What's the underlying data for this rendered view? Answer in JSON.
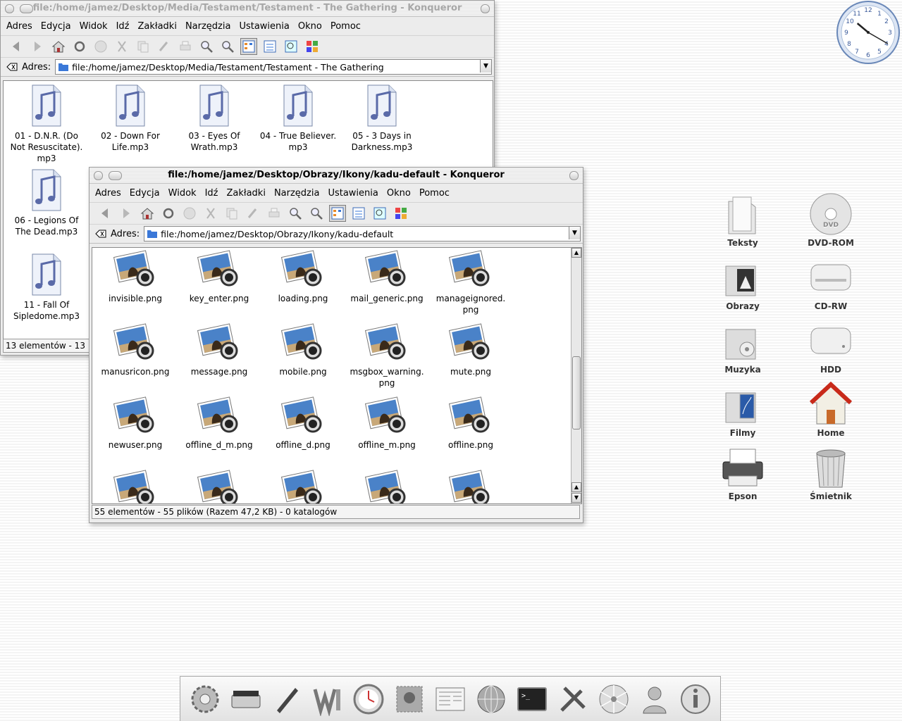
{
  "window1": {
    "title": "file:/home/jamez/Desktop/Media/Testament/Testament - The Gathering - Konqueror",
    "menu": [
      "Adres",
      "Edycja",
      "Widok",
      "Idź",
      "Zakładki",
      "Narzędzia",
      "Ustawienia",
      "Okno",
      "Pomoc"
    ],
    "address_label": "Adres:",
    "address_value": "file:/home/jamez/Desktop/Media/Testament/Testament - The Gathering",
    "files": [
      {
        "l1": "01 - D.N.R. (Do",
        "l2": "Not Resuscitate).",
        "l3": "mp3"
      },
      {
        "l1": "02 - Down For",
        "l2": "Life.mp3",
        "l3": ""
      },
      {
        "l1": "03 - Eyes Of",
        "l2": "Wrath.mp3",
        "l3": ""
      },
      {
        "l1": "04 - True Believer.",
        "l2": "mp3",
        "l3": ""
      },
      {
        "l1": "05 - 3 Days in",
        "l2": "Darkness.mp3",
        "l3": ""
      },
      {
        "l1": "06 - Legions Of",
        "l2": "The Dead.mp3",
        "l3": ""
      },
      {
        "l1": "11 - Fall Of",
        "l2": "Sipledome.mp3",
        "l3": ""
      }
    ],
    "status": "13 elementów - 13"
  },
  "window2": {
    "title": "file:/home/jamez/Desktop/Obrazy/Ikony/kadu-default - Konqueror",
    "menu": [
      "Adres",
      "Edycja",
      "Widok",
      "Idź",
      "Zakładki",
      "Narzędzia",
      "Ustawienia",
      "Okno",
      "Pomoc"
    ],
    "address_label": "Adres:",
    "address_value": "file:/home/jamez/Desktop/Obrazy/Ikony/kadu-default",
    "files": [
      {
        "l1": "invisible.png",
        "l2": ""
      },
      {
        "l1": "key_enter.png",
        "l2": ""
      },
      {
        "l1": "loading.png",
        "l2": ""
      },
      {
        "l1": "mail_generic.png",
        "l2": ""
      },
      {
        "l1": "manageignored.",
        "l2": "png"
      },
      {
        "l1": "manusricon.png",
        "l2": ""
      },
      {
        "l1": "message.png",
        "l2": ""
      },
      {
        "l1": "mobile.png",
        "l2": ""
      },
      {
        "l1": "msgbox_warning.",
        "l2": "png"
      },
      {
        "l1": "mute.png",
        "l2": ""
      },
      {
        "l1": "newuser.png",
        "l2": ""
      },
      {
        "l1": "offline_d_m.png",
        "l2": ""
      },
      {
        "l1": "offline_d.png",
        "l2": ""
      },
      {
        "l1": "offline_m.png",
        "l2": ""
      },
      {
        "l1": "offline.png",
        "l2": ""
      },
      {
        "l1": "",
        "l2": ""
      },
      {
        "l1": "",
        "l2": ""
      },
      {
        "l1": "",
        "l2": ""
      },
      {
        "l1": "",
        "l2": ""
      },
      {
        "l1": "",
        "l2": ""
      }
    ],
    "status": "55 elementów - 55 plików (Razem 47,2 KB) - 0 katalogów"
  },
  "desktop_icons": [
    {
      "label": "Teksty",
      "icon": "documents-folder-icon"
    },
    {
      "label": "DVD-ROM",
      "icon": "dvd-icon"
    },
    {
      "label": "Obrazy",
      "icon": "pictures-folder-icon"
    },
    {
      "label": "CD-RW",
      "icon": "cd-drive-icon"
    },
    {
      "label": "Muzyka",
      "icon": "music-folder-icon"
    },
    {
      "label": "HDD",
      "icon": "hard-disk-icon"
    },
    {
      "label": "Filmy",
      "icon": "movies-folder-icon"
    },
    {
      "label": "Home",
      "icon": "home-icon"
    },
    {
      "label": "Epson",
      "icon": "printer-icon"
    },
    {
      "label": "Śmietnik",
      "icon": "trash-icon"
    }
  ],
  "clock": {
    "hours": 10,
    "minutes": 20
  },
  "dock_icons": [
    "settings-gear-icon",
    "scanner-icon",
    "pen-icon",
    "office-icon",
    "clock-app-icon",
    "photo-stamp-icon",
    "newspaper-icon",
    "globe-icon",
    "terminal-icon",
    "tools-icon",
    "disc-burn-icon",
    "user-icon",
    "info-icon"
  ],
  "colors": {
    "folder_blue": "#3a78d8",
    "mp3_doc": "#e8eef8",
    "note": "#5a6aa8"
  }
}
